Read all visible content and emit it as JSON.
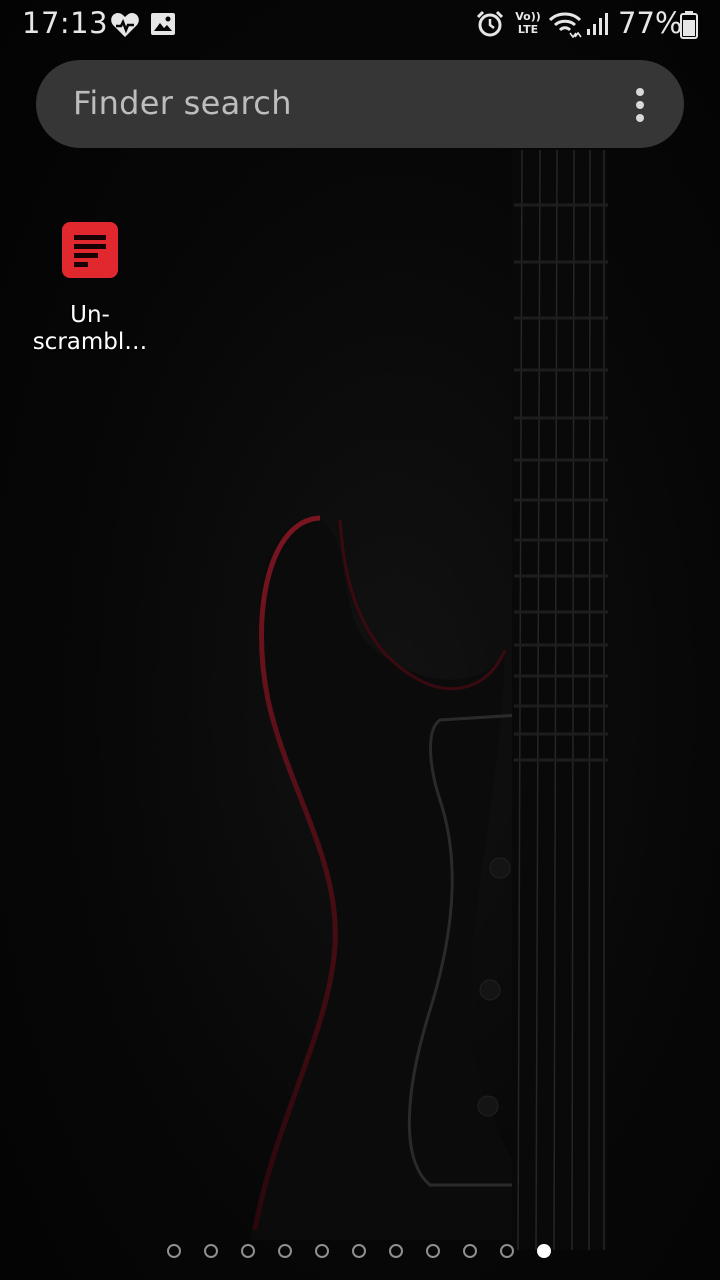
{
  "status_bar": {
    "time": "17:13",
    "battery_percent": "77%",
    "left_icons": [
      "health-heart-icon",
      "gallery-image-icon"
    ],
    "right_icons": [
      "alarm-clock-icon",
      "volte-icon",
      "wifi-icon",
      "signal-icon",
      "battery-icon"
    ],
    "volte_label_top": "Vo))",
    "volte_label_bottom": "LTE"
  },
  "search": {
    "placeholder": "Finder search",
    "menu_icon": "more-vertical-icon"
  },
  "apps": [
    {
      "label": "Un-scrambl…",
      "icon": "document-lines-icon",
      "icon_color": "#e0282e"
    }
  ],
  "app_label_lines": [
    "Un-",
    "scrambl…"
  ],
  "page_indicator": {
    "total": 11,
    "active_page": 11
  },
  "colors": {
    "search_bar_bg": "#363636",
    "accent_red": "#e0282e",
    "background": "#050505"
  }
}
